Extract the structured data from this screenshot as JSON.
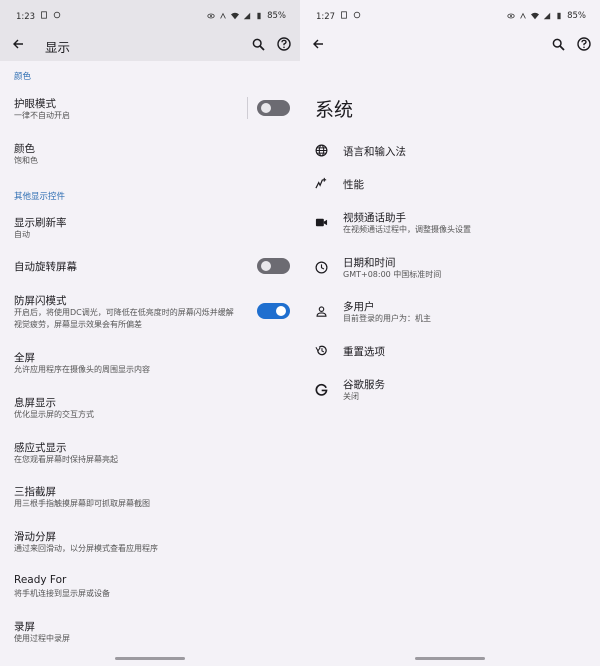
{
  "left": {
    "status": {
      "time": "1:23",
      "battery": "85%"
    },
    "appbar": {
      "title": "显示"
    },
    "sections": {
      "color_header": "颜色",
      "other_header": "其他显示控件"
    },
    "items": [
      {
        "title": "护眼模式",
        "summary": "一律不自动开启",
        "toggle": "off"
      },
      {
        "title": "颜色",
        "summary": "饱和色"
      },
      {
        "title": "显示刷新率",
        "summary": "自动"
      },
      {
        "title": "自动旋转屏幕",
        "toggle": "off"
      },
      {
        "title": "防屏闪模式",
        "summary": "开启后，将使用DC调光，可降低在低亮度时的屏幕闪烁并缓解",
        "summary2": "视觉疲劳，屏幕显示效果会有所偏差",
        "toggle": "on"
      },
      {
        "title": "全屏",
        "summary": "允许应用程序在摄像头的周围显示内容"
      },
      {
        "title": "息屏显示",
        "summary": "优化显示屏的交互方式"
      },
      {
        "title": "感应式显示",
        "summary": "在您观看屏幕时保持屏幕亮起"
      },
      {
        "title": "三指截屏",
        "summary": "用三根手指触摸屏幕即可抓取屏幕截图"
      },
      {
        "title": "滑动分屏",
        "summary": "通过来回滑动，以分屏模式查看应用程序"
      },
      {
        "title": "Ready For",
        "summary": "将手机连接到显示屏或设备"
      },
      {
        "title": "录屏",
        "summary": "使用过程中录屏"
      }
    ]
  },
  "right": {
    "status": {
      "time": "1:27",
      "battery": "85%"
    },
    "title": "系统",
    "items": [
      {
        "icon": "globe-icon",
        "title": "语言和输入法"
      },
      {
        "icon": "performance-icon",
        "title": "性能"
      },
      {
        "icon": "video-call-icon",
        "title": "视频通话助手",
        "summary": "在视频通话过程中，调整摄像头设置"
      },
      {
        "icon": "clock-icon",
        "title": "日期和时间",
        "summary": "GMT+08:00 中国标准时间"
      },
      {
        "icon": "person-icon",
        "title": "多用户",
        "summary": "目前登录的用户为：机主"
      },
      {
        "icon": "restore-icon",
        "title": "重置选项"
      },
      {
        "icon": "google-icon",
        "title": "谷歌服务",
        "summary": "关闭"
      }
    ]
  }
}
